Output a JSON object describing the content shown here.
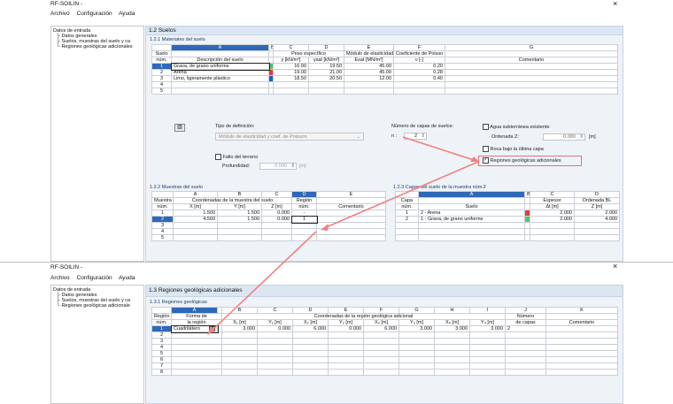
{
  "window1": {
    "title": "RF-SOILIN -",
    "close": "×",
    "menu": [
      "Archivo",
      "Configuración",
      "Ayuda"
    ],
    "tree": [
      "Datos de entrada",
      "Datos generales",
      "Suelos, muestras del suelo y ca",
      "Regiones geológicas adicionales"
    ],
    "section_title": "1.2 Suelos",
    "soil_section": "1.2.1 Materiales del suelo",
    "soil_table": {
      "col_letters": [
        "A",
        "B",
        "C",
        "D",
        "E",
        "F",
        "G"
      ],
      "head1": [
        "Suelo",
        "",
        "Peso específico",
        "Módulo de elasticidad",
        "Coeficiente de Poisso",
        "",
        "Comentario"
      ],
      "head2": [
        "núm.",
        "Descripción del suelo",
        "γ [kN/m³]",
        "γsat [kN/m³]",
        "Esat [MN/m²]",
        "ν [-]",
        ""
      ],
      "rows": [
        {
          "n": "1",
          "desc": "Grava, de grano uniforme",
          "g": "16.00",
          "gs": "19.50",
          "e": "45.00",
          "v": "0.20",
          "color": "#55c470"
        },
        {
          "n": "2",
          "desc": "Arena",
          "g": "19.00",
          "gs": "21.00",
          "e": "45.00",
          "v": "0.28",
          "color": "#e63a3a"
        },
        {
          "n": "3",
          "desc": "Limo, ligeramente plástico",
          "g": "18.50",
          "gs": "20.50",
          "e": "12.00",
          "v": "0.40",
          "color": "#1e5bd6"
        },
        {
          "n": "4",
          "desc": "",
          "g": "",
          "gs": "",
          "e": "",
          "v": "",
          "color": ""
        },
        {
          "n": "5",
          "desc": "",
          "g": "",
          "gs": "",
          "e": "",
          "v": "",
          "color": ""
        }
      ]
    },
    "controls": {
      "tipo_label": "Tipo de definición:",
      "tipo_value": "Módulo de elasticidad y coef. de Poisson",
      "fallo": "Fallo del terreno",
      "profundidad_label": "Profundidad:",
      "profundidad_value": "0.500",
      "profundidad_unit": "[m]",
      "capas_label": "Número de capas de suelos:",
      "capas_n": "n :",
      "capas_value": "2",
      "agua": "Agua subterránea existente",
      "ordenada_label": "Ordenada Z:",
      "ordenada_value": "0.000",
      "ordenada_unit": "[m]",
      "roca": "Roca bajo la última capa",
      "regiones": "Regiones geológicas adicionales"
    },
    "samples_section": "1.2.2 Muestras del suelo",
    "samples_table": {
      "col_letters": [
        "A",
        "B",
        "C",
        "D",
        "E"
      ],
      "head1": [
        "Muestra",
        "Coordenadas de la muestra del suelo",
        "",
        "",
        "Región",
        ""
      ],
      "head2": [
        "núm.",
        "X [m]",
        "Y [m]",
        "Z [m]",
        "núm.",
        "Comentario"
      ],
      "rows": [
        {
          "n": "1",
          "x": "1.500",
          "y": "1.500",
          "z": "0.000",
          "r": "-"
        },
        {
          "n": "2",
          "x": "4.500",
          "y": "1.500",
          "z": "0.000",
          "r": "1"
        },
        {
          "n": "3",
          "x": "",
          "y": "",
          "z": "",
          "r": ""
        },
        {
          "n": "4",
          "x": "",
          "y": "",
          "z": "",
          "r": ""
        },
        {
          "n": "5",
          "x": "",
          "y": "",
          "z": "",
          "r": ""
        }
      ]
    },
    "layers_section": "1.2.3 Capas del suelo de la muestra núm.2",
    "layers_table": {
      "col_letters": [
        "A",
        "B",
        "C",
        "D"
      ],
      "head1": [
        "Capa",
        "",
        "Espesor",
        "Ordenada BL"
      ],
      "head2": [
        "núm.",
        "Suelo",
        "Δt [m]",
        "Z [m]"
      ],
      "rows": [
        {
          "n": "1",
          "s": "2 - Arena",
          "t": "2.000",
          "z": "2.000",
          "color": "#e63a3a"
        },
        {
          "n": "2",
          "s": "1 - Grava, de grano uniforme",
          "t": "2.000",
          "z": "4.000",
          "color": "#55c470"
        }
      ]
    }
  },
  "window2": {
    "title": "RF-SOILIN -",
    "close": "×",
    "menu": [
      "Archivo",
      "Configuración",
      "Ayuda"
    ],
    "tree": [
      "Datos de entrada",
      "Datos generales",
      "Suelos, muestras del suelo y ca",
      "Regiones geológicas adicionale"
    ],
    "section_title": "1.3 Regiones geológicas adicionales",
    "sub_section": "1.3.1 Regiones geológicas",
    "table": {
      "col_letters": [
        "A",
        "B",
        "C",
        "D",
        "E",
        "F",
        "G",
        "H",
        "I",
        "J",
        "K"
      ],
      "head1": [
        "Región",
        "Forma de",
        "Coordenadas de la región geológica adicional",
        "Número",
        ""
      ],
      "head2": [
        "núm.",
        "la región",
        "X₁ [m]",
        "Y₁ [m]",
        "X₂ [m]",
        "Y₂ [m]",
        "X₃ [m]",
        "Y₃ [m]",
        "X₄ [m]",
        "Y₄ [m]",
        "de capas",
        "Comentario"
      ],
      "row1": {
        "n": "1",
        "forma": "Cuadrilátero",
        "x1": "3.000",
        "y1": "0.000",
        "x2": "6.000",
        "y2": "0.000",
        "x3": "6.000",
        "y3": "3.000",
        "x4": "3.000",
        "y4": "3.000",
        "capas": "2"
      },
      "empty_rows": [
        "2",
        "3",
        "4",
        "5",
        "6",
        "7",
        "8"
      ]
    }
  }
}
